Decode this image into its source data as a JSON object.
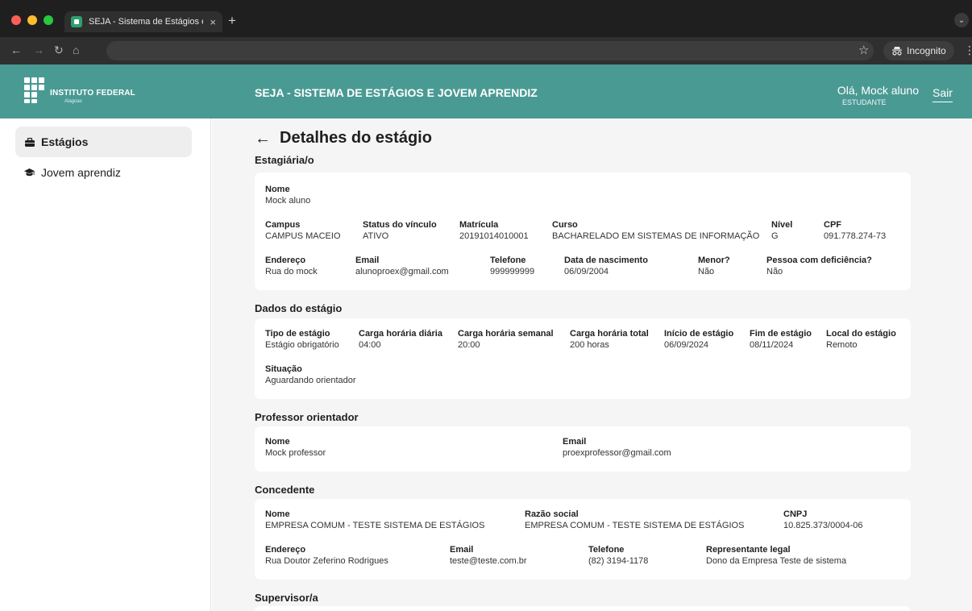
{
  "browser": {
    "tab_title": "SEJA - Sistema de Estágios e Jovem Aprendiz",
    "tab_close": "×",
    "new_tab": "+",
    "incognito_label": "Incognito"
  },
  "header": {
    "logo_text": "INSTITUTO FEDERAL",
    "logo_sub": "Alagoas",
    "app_title": "SEJA - SISTEMA DE ESTÁGIOS E JOVEM APRENDIZ",
    "greeting": "Olá, Mock aluno",
    "role": "ESTUDANTE",
    "logout": "Sair"
  },
  "sidebar": {
    "items": [
      {
        "label": "Estágios",
        "icon": "briefcase-icon",
        "active": true
      },
      {
        "label": "Jovem aprendiz",
        "icon": "graduation-cap-icon",
        "active": false
      }
    ]
  },
  "page": {
    "back_icon": "←",
    "title": "Detalhes do estágio"
  },
  "estagiario": {
    "title": "Estagiária/o",
    "nome": {
      "label": "Nome",
      "value": "Mock aluno"
    },
    "campus": {
      "label": "Campus",
      "value": "CAMPUS MACEIO"
    },
    "status": {
      "label": "Status do vínculo",
      "value": "ATIVO"
    },
    "matricula": {
      "label": "Matrícula",
      "value": "20191014010001"
    },
    "curso": {
      "label": "Curso",
      "value": "BACHARELADO EM SISTEMAS DE INFORMAÇÃO"
    },
    "nivel": {
      "label": "Nível",
      "value": "G"
    },
    "cpf": {
      "label": "CPF",
      "value": "091.778.274-73"
    },
    "endereco": {
      "label": "Endereço",
      "value": "Rua do mock"
    },
    "email": {
      "label": "Email",
      "value": "alunoproex@gmail.com"
    },
    "telefone": {
      "label": "Telefone",
      "value": "999999999"
    },
    "nascimento": {
      "label": "Data de nascimento",
      "value": "06/09/2004"
    },
    "menor": {
      "label": "Menor?",
      "value": "Não"
    },
    "deficiencia": {
      "label": "Pessoa com deficiência?",
      "value": "Não"
    }
  },
  "dados_estagio": {
    "title": "Dados do estágio",
    "tipo": {
      "label": "Tipo de estágio",
      "value": "Estágio obrigatório"
    },
    "ch_diaria": {
      "label": "Carga horária diária",
      "value": "04:00"
    },
    "ch_semanal": {
      "label": "Carga horária semanal",
      "value": "20:00"
    },
    "ch_total": {
      "label": "Carga horária total",
      "value": "200 horas"
    },
    "inicio": {
      "label": "Início de estágio",
      "value": "06/09/2024"
    },
    "fim": {
      "label": "Fim de estágio",
      "value": "08/11/2024"
    },
    "local": {
      "label": "Local do estágio",
      "value": "Remoto"
    },
    "situacao": {
      "label": "Situação",
      "value": "Aguardando orientador"
    }
  },
  "orientador": {
    "title": "Professor orientador",
    "nome": {
      "label": "Nome",
      "value": "Mock professor"
    },
    "email": {
      "label": "Email",
      "value": "proexprofessor@gmail.com"
    }
  },
  "concedente": {
    "title": "Concedente",
    "nome": {
      "label": "Nome",
      "value": "EMPRESA COMUM - TESTE SISTEMA DE ESTÁGIOS"
    },
    "razao": {
      "label": "Razão social",
      "value": "EMPRESA COMUM - TESTE SISTEMA DE ESTÁGIOS"
    },
    "cnpj": {
      "label": "CNPJ",
      "value": "10.825.373/0004-06"
    },
    "endereco": {
      "label": "Endereço",
      "value": "Rua Doutor Zeferino Rodrigues"
    },
    "email": {
      "label": "Email",
      "value": "teste@teste.com.br"
    },
    "telefone": {
      "label": "Telefone",
      "value": "(82) 3194-1178"
    },
    "representante": {
      "label": "Representante legal",
      "value": "Dono da Empresa Teste de sistema"
    }
  },
  "supervisor": {
    "title": "Supervisor/a"
  }
}
